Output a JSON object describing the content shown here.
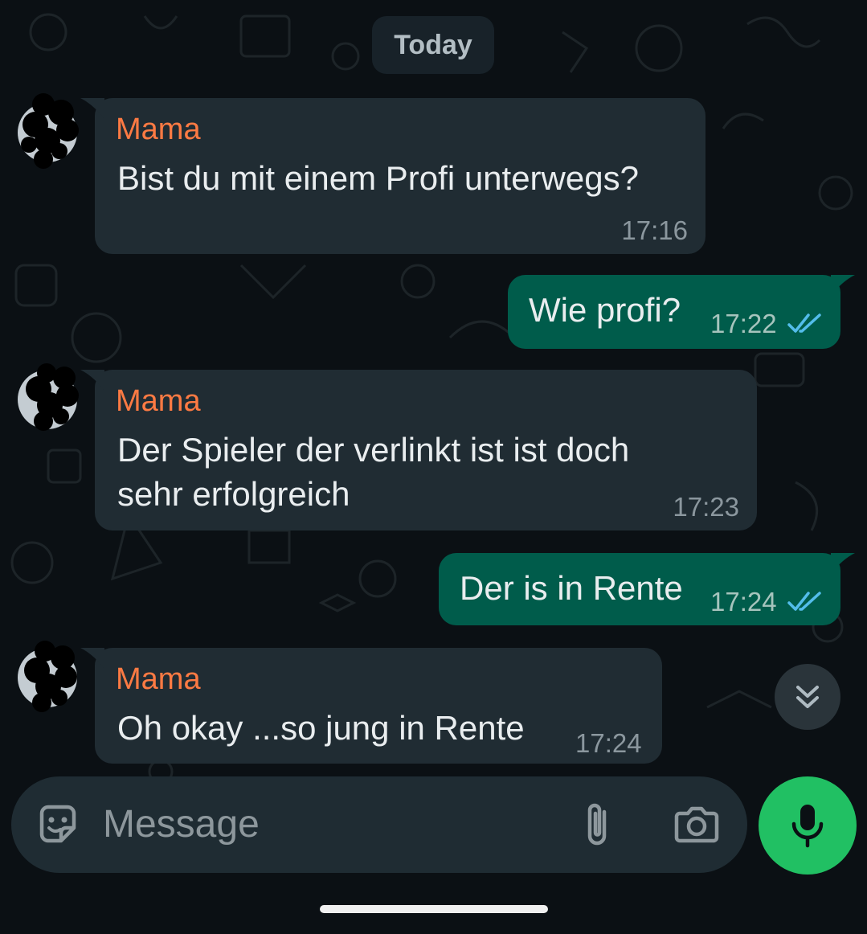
{
  "date_separator": "Today",
  "messages": [
    {
      "direction": "incoming",
      "sender": "Mama",
      "text": "Bist du mit einem Profi unterwegs?",
      "time": "17:16"
    },
    {
      "direction": "outgoing",
      "text": "Wie profi?",
      "time": "17:22",
      "status": "read"
    },
    {
      "direction": "incoming",
      "sender": "Mama",
      "text": "Der Spieler der verlinkt ist ist doch\nsehr erfolgreich",
      "time": "17:23"
    },
    {
      "direction": "outgoing",
      "text": "Der is in Rente",
      "time": "17:24",
      "status": "read"
    },
    {
      "direction": "incoming",
      "sender": "Mama",
      "text": "Oh okay ...so jung in Rente",
      "time": "17:24"
    }
  ],
  "composer": {
    "placeholder": "Message",
    "icons": [
      "sticker-emoji-icon",
      "paperclip-icon",
      "camera-icon"
    ],
    "send_action_icon": "microphone-icon"
  },
  "scroll_button_icon": "double-chevron-down-icon",
  "colors": {
    "background": "#0b1014",
    "incoming_bubble": "#202c33",
    "outgoing_bubble": "#005c4b",
    "sender_name": "#fc7a43",
    "read_ticks": "#53bdeb",
    "mic_button": "#21c063"
  }
}
